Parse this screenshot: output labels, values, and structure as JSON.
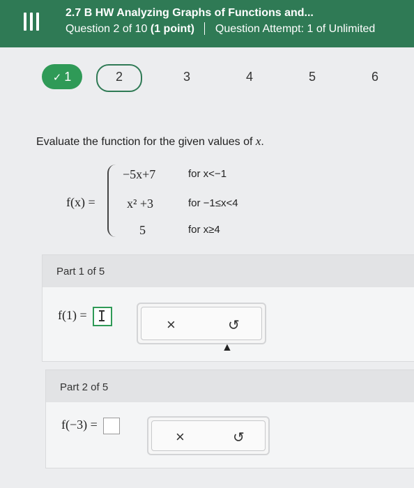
{
  "header": {
    "title": "2.7 B HW Analyzing Graphs of Functions and...",
    "question": "Question 2 of 10",
    "points": "(1 point)",
    "attempt": "Question Attempt: 1 of Unlimited"
  },
  "nav": {
    "check_glyph": "✓",
    "questions": [
      "1",
      "2",
      "3",
      "4",
      "5",
      "6"
    ]
  },
  "prompt": {
    "text": "Evaluate the function for the given values of",
    "var": "x",
    "end": "."
  },
  "func": {
    "lhs": "f(x) =",
    "pieces": [
      {
        "expr": "−5x+7",
        "cond": "for x<−1"
      },
      {
        "expr": "x² +3",
        "cond": "for −1≤x<4"
      },
      {
        "expr": "5",
        "cond": "for x≥4"
      }
    ]
  },
  "parts": [
    {
      "label": "Part 1 of 5",
      "expr": "f(1) ="
    },
    {
      "label": "Part 2 of 5",
      "expr": "f(−3) ="
    }
  ],
  "tools": {
    "clear_glyph": "×",
    "undo_glyph": "↺"
  }
}
